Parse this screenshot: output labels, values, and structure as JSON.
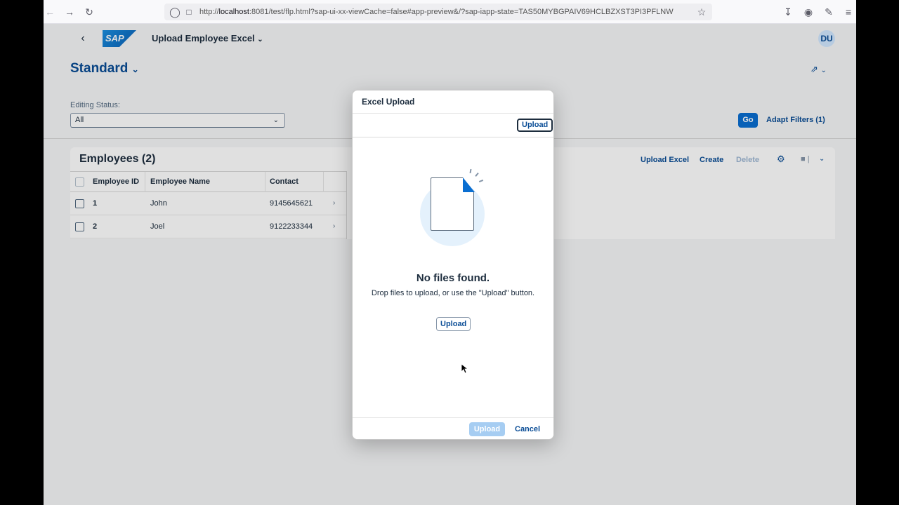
{
  "browser": {
    "url_prefix": "http://",
    "url_host": "localhost",
    "url_rest": ":8081/test/flp.html?sap-ui-xx-viewCache=false#app-preview&/?sap-iapp-state=TAS50MYBGPAIV69HCLBZXST3PI3PFLNW"
  },
  "shell": {
    "logo_text": "SAP",
    "app_title": "Upload Employee Excel",
    "avatar_initials": "DU"
  },
  "filters": {
    "variant": "Standard",
    "editing_status_label": "Editing Status:",
    "editing_status_value": "All",
    "go_label": "Go",
    "adapt_label": "Adapt Filters (1)"
  },
  "table": {
    "title": "Employees (2)",
    "upload_excel": "Upload Excel",
    "create": "Create",
    "delete": "Delete",
    "headers": [
      "Employee ID",
      "Employee Name",
      "Contact"
    ],
    "rows": [
      {
        "id": "1",
        "name": "John",
        "contact": "9145645621"
      },
      {
        "id": "2",
        "name": "Joel",
        "contact": "9122233344"
      }
    ]
  },
  "dialog": {
    "title": "Excel Upload",
    "toolbar_upload": "Upload",
    "empty_title": "No files found.",
    "empty_hint": "Drop files to upload, or use the \"Upload\" button.",
    "center_upload": "Upload",
    "footer_upload": "Upload",
    "footer_cancel": "Cancel"
  }
}
